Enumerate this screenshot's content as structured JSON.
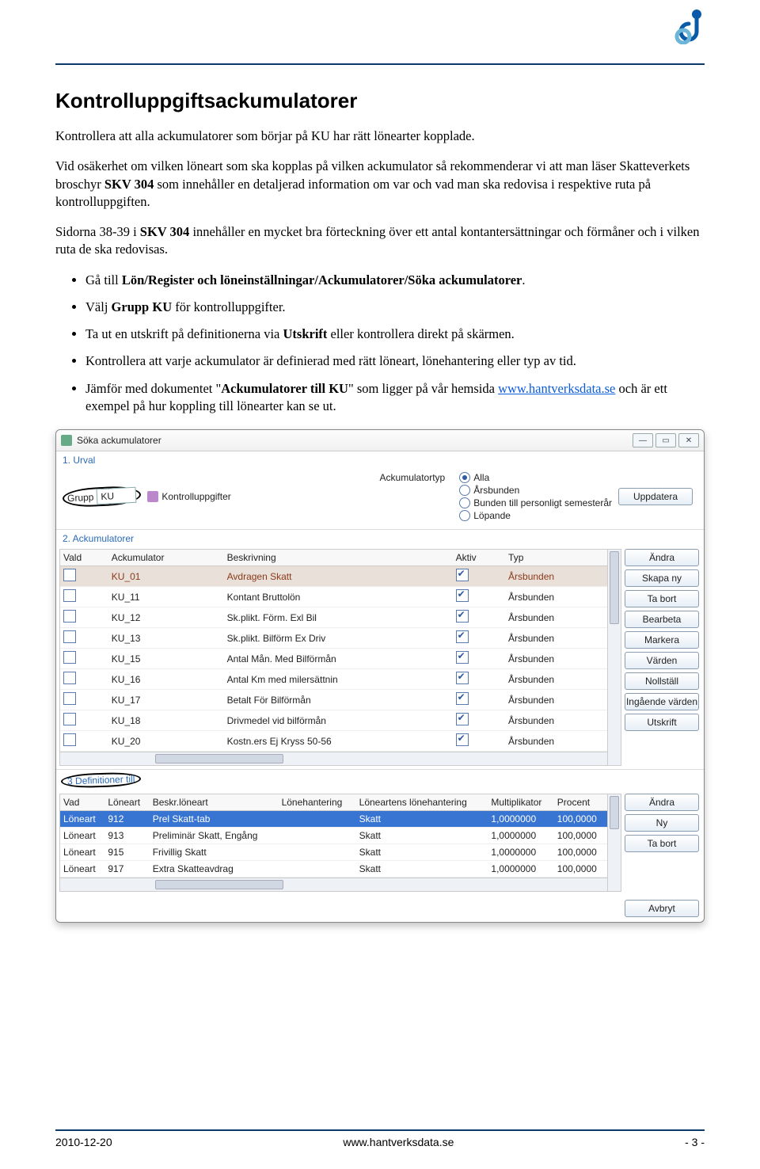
{
  "logo_colors": {
    "top": "#0a5aa8",
    "bottom": "#6cb5d8"
  },
  "heading": "Kontrolluppgiftsackumulatorer",
  "intro": "Kontrollera att alla ackumulatorer som börjar på KU har rätt lönearter kopplade.",
  "para2_a": "Vid osäkerhet om vilken löneart som ska kopplas på vilken ackumulator så rekommenderar vi att man läser Skatteverkets broschyr ",
  "para2_b": "SKV 304",
  "para2_c": " som innehåller en detaljerad information om var och vad man ska redovisa i respektive ruta på kontrolluppgiften.",
  "para3_a": "Sidorna 38-39 i ",
  "para3_b": "SKV 304",
  "para3_c": " innehåller en mycket bra förteckning över ett antal kontantersättningar och förmåner och i vilken ruta de ska redovisas.",
  "bullets": {
    "b1_a": "Gå till ",
    "b1_b": "Lön/Register och löneinställningar/Ackumulatorer/Söka ackumulatorer",
    "b1_c": ".",
    "b2_a": "Välj ",
    "b2_b": "Grupp KU",
    "b2_c": " för kontrolluppgifter.",
    "b3_a": "Ta ut en utskrift på definitionerna via ",
    "b3_b": "Utskrift",
    "b3_c": " eller kontrollera direkt på skärmen.",
    "b4": "Kontrollera att varje ackumulator är definierad med rätt löneart, lönehantering eller typ av tid.",
    "b5_a": "Jämför med dokumentet \"",
    "b5_b": "Ackumulatorer till KU",
    "b5_c": "\" som ligger på vår hemsida ",
    "b5_link": "www.hantverksdata.se",
    "b5_d": " och är ett exempel på hur koppling till lönearter kan se ut."
  },
  "win": {
    "title": "Söka ackumulatorer",
    "sec1": "1. Urval",
    "grupp_label": "Grupp",
    "grupp_value": "KU",
    "kontroll": "Kontrolluppgifter",
    "acktyp_label": "Ackumulatortyp",
    "radios": [
      "Alla",
      "Årsbunden",
      "Bunden till personligt semesterår",
      "Löpande"
    ],
    "btn_uppdatera": "Uppdatera",
    "sec2": "2. Ackumulatorer",
    "headers2": [
      "Vald",
      "Ackumulator",
      "Beskrivning",
      "Aktiv",
      "Typ"
    ],
    "rows2": [
      {
        "ack": "KU_01",
        "beskr": "Avdragen Skatt",
        "aktiv": true,
        "typ": "Årsbunden",
        "sel": true
      },
      {
        "ack": "KU_11",
        "beskr": "Kontant Bruttolön",
        "aktiv": true,
        "typ": "Årsbunden"
      },
      {
        "ack": "KU_12",
        "beskr": "Sk.plikt. Förm. Exl Bil",
        "aktiv": true,
        "typ": "Årsbunden"
      },
      {
        "ack": "KU_13",
        "beskr": "Sk.plikt. Bilförm Ex Driv",
        "aktiv": true,
        "typ": "Årsbunden"
      },
      {
        "ack": "KU_15",
        "beskr": "Antal Mån. Med Bilförmån",
        "aktiv": true,
        "typ": "Årsbunden"
      },
      {
        "ack": "KU_16",
        "beskr": "Antal Km med milersättnin",
        "aktiv": true,
        "typ": "Årsbunden"
      },
      {
        "ack": "KU_17",
        "beskr": "Betalt För Bilförmån",
        "aktiv": true,
        "typ": "Årsbunden"
      },
      {
        "ack": "KU_18",
        "beskr": "Drivmedel vid bilförmån",
        "aktiv": true,
        "typ": "Årsbunden"
      },
      {
        "ack": "KU_20",
        "beskr": "Kostn.ers Ej Kryss 50-56",
        "aktiv": true,
        "typ": "Årsbunden"
      }
    ],
    "btns2": [
      "Ändra",
      "Skapa ny",
      "Ta bort",
      "Bearbeta",
      "Markera",
      "Värden",
      "Nollställ",
      "Ingående värden",
      "Utskrift"
    ],
    "sec3": "3 Definitioner till",
    "headers3": [
      "Vad",
      "Löneart",
      "Beskr.löneart",
      "Lönehantering",
      "Löneartens lönehantering",
      "Multiplikator",
      "Procent"
    ],
    "rows3": [
      {
        "vad": "Löneart",
        "lart": "912",
        "beskr": "Prel Skatt-tab",
        "lh": "",
        "llh": "Skatt",
        "mult": "1,0000000",
        "proc": "100,0000",
        "sel": true
      },
      {
        "vad": "Löneart",
        "lart": "913",
        "beskr": "Preliminär Skatt, Engång",
        "lh": "",
        "llh": "Skatt",
        "mult": "1,0000000",
        "proc": "100,0000"
      },
      {
        "vad": "Löneart",
        "lart": "915",
        "beskr": "Frivillig Skatt",
        "lh": "",
        "llh": "Skatt",
        "mult": "1,0000000",
        "proc": "100,0000"
      },
      {
        "vad": "Löneart",
        "lart": "917",
        "beskr": "Extra Skatteavdrag",
        "lh": "",
        "llh": "Skatt",
        "mult": "1,0000000",
        "proc": "100,0000"
      }
    ],
    "btns3": [
      "Ändra",
      "Ny",
      "Ta bort"
    ],
    "btn_avbryt": "Avbryt"
  },
  "footer": {
    "left": "2010-12-20",
    "center": "www.hantverksdata.se",
    "right": "- 3 -"
  }
}
